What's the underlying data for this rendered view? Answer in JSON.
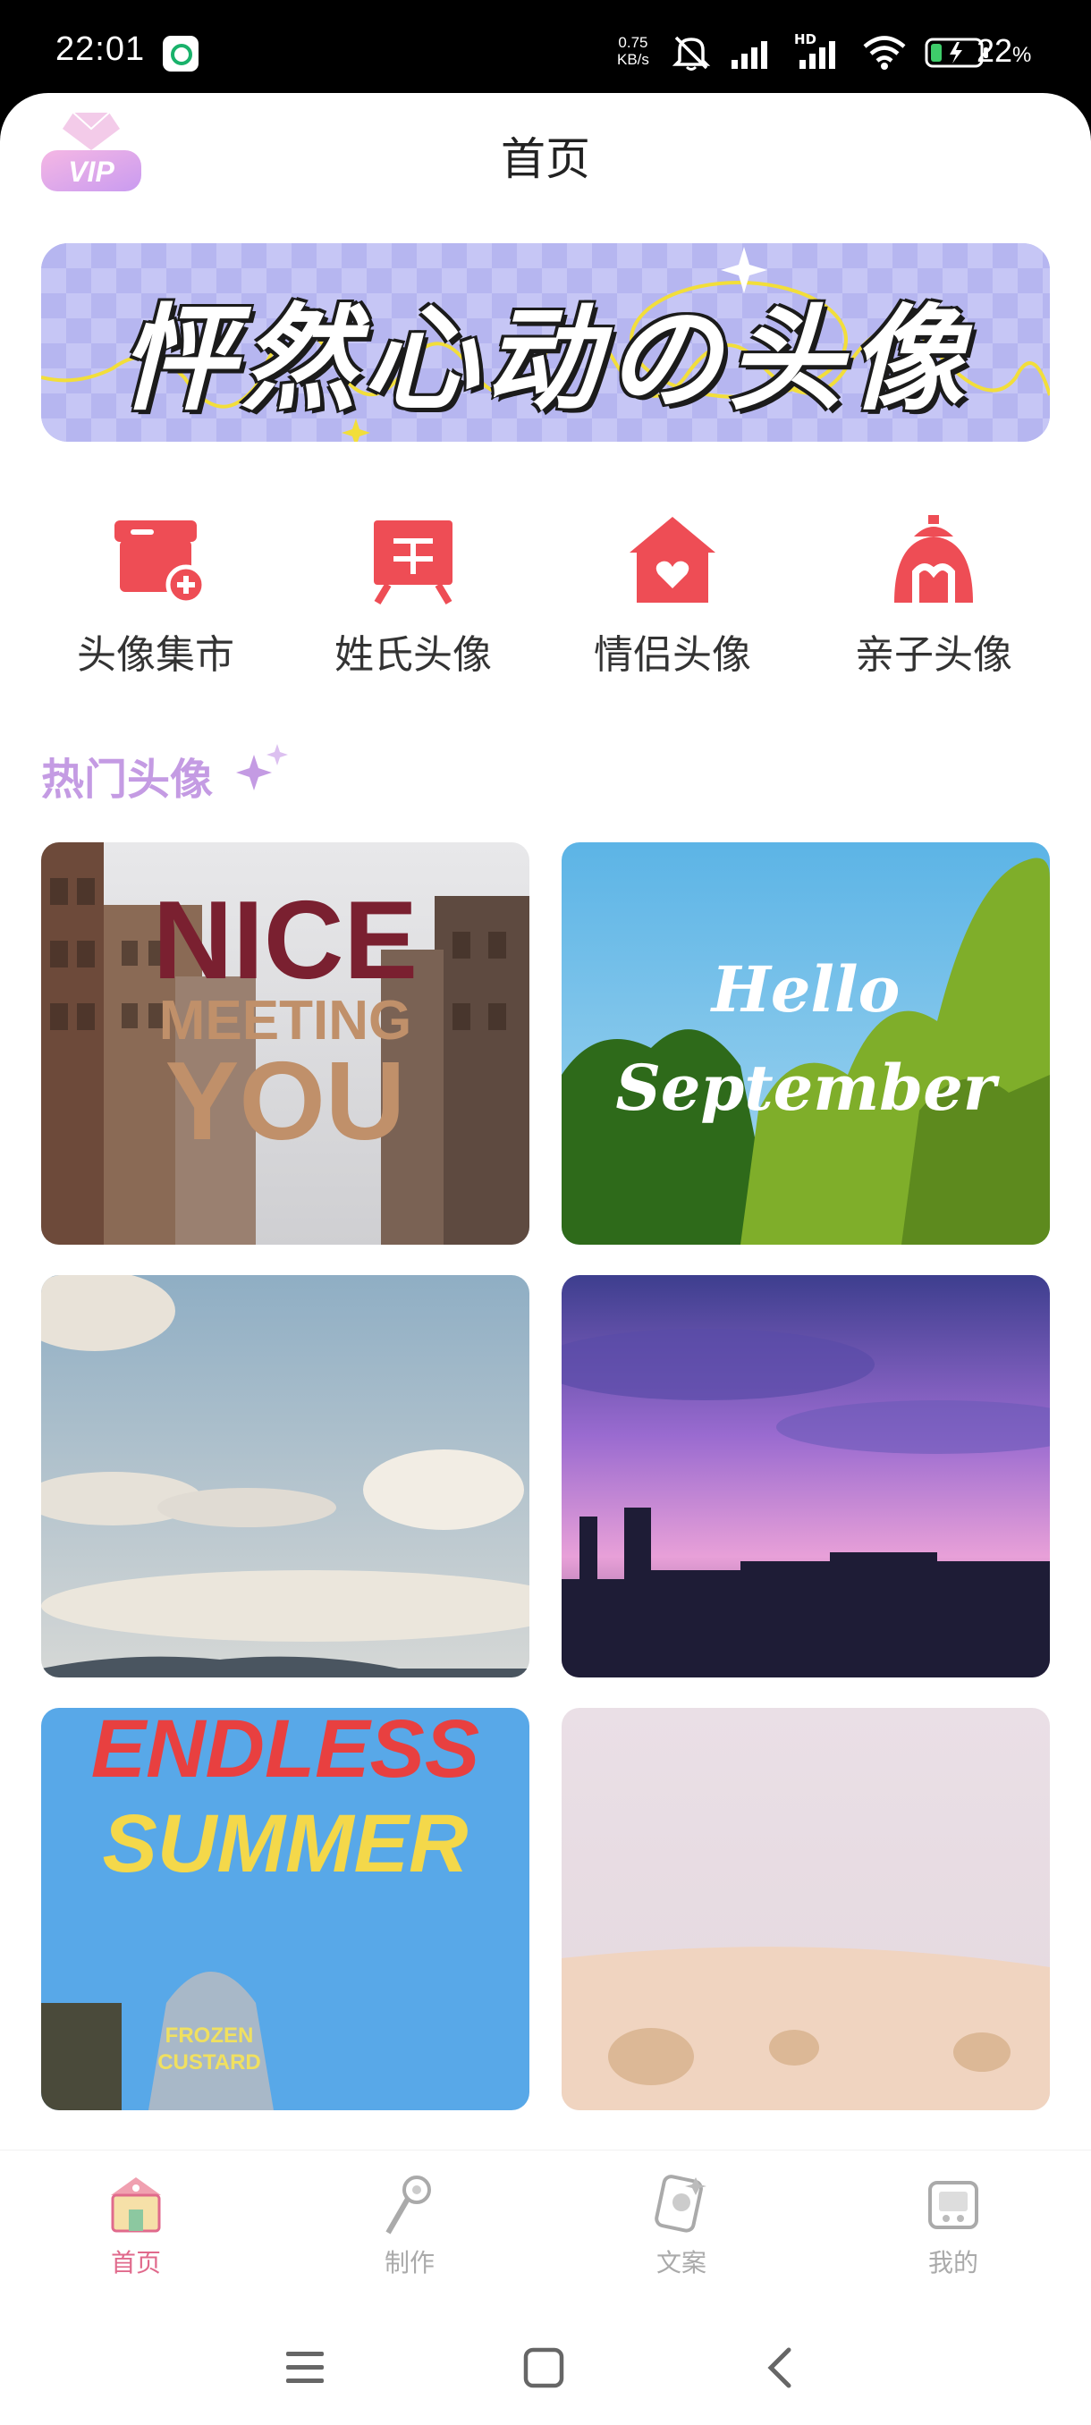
{
  "status_bar": {
    "time": "22:01",
    "net_speed_value": "0.75",
    "net_speed_unit": "KB/s",
    "network_badge": "HD",
    "battery_percent": "22",
    "battery_unit": "%"
  },
  "header": {
    "vip_badge": "VIP",
    "title": "首页"
  },
  "banner": {
    "text": "怦然心动の头像"
  },
  "categories": [
    {
      "label": "头像集市",
      "icon": "market-stall-icon"
    },
    {
      "label": "姓氏头像",
      "icon": "surname-sign-icon"
    },
    {
      "label": "情侣头像",
      "icon": "heart-house-icon"
    },
    {
      "label": "亲子头像",
      "icon": "family-dome-icon"
    }
  ],
  "hot_section": {
    "title": "热门头像"
  },
  "tiles": [
    {
      "line1": "NICE",
      "line2": "MEETING",
      "line3": "YOU"
    },
    {
      "line1": "Hello",
      "line2": "September"
    },
    {},
    {},
    {
      "line1": "ENDLESS",
      "line2": "SUMMER",
      "sign1": "FROZEN",
      "sign2": "CUSTARD"
    },
    {}
  ],
  "tabs": [
    {
      "label": "首页",
      "active": true
    },
    {
      "label": "制作",
      "active": false
    },
    {
      "label": "文案",
      "active": false
    },
    {
      "label": "我的",
      "active": false
    }
  ],
  "colors": {
    "accent_pink": "#e06a8c",
    "icon_red": "#ee4d55",
    "section_purple": "#c49be3",
    "banner_bg": "#c8c8f6"
  }
}
